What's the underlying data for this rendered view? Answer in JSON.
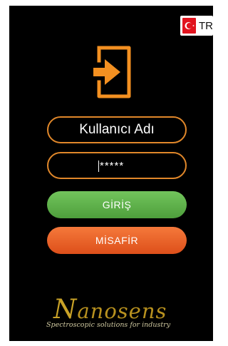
{
  "language": {
    "code": "TR",
    "flag_icon": "turkey-flag-icon"
  },
  "header": {
    "icon": "login-icon",
    "icon_color": "#f39021"
  },
  "form": {
    "username_placeholder": "Kullanıcı Adı",
    "password_value": "*****"
  },
  "buttons": {
    "login_label": "GİRİŞ",
    "login_color": "#5fb347",
    "guest_label": "MİSAFİR",
    "guest_color": "#ee6428"
  },
  "brand": {
    "name_initial": "N",
    "name_rest": "anosens",
    "tagline": "Spectroscopic solutions for industry"
  }
}
